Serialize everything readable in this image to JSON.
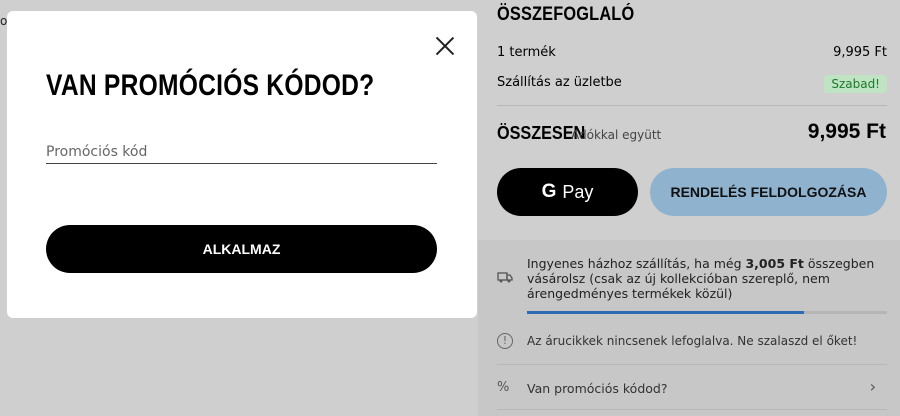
{
  "background_hint": {
    "left_edge_text": "o"
  },
  "summary": {
    "title": "ÖSSZEFOGLALÓ",
    "items_label": "1 termék",
    "items_value": "9,995 Ft",
    "shipping_label": "Szállítás az üzletbe",
    "shipping_badge": "Szabad!",
    "total_label": "ÖSSZESEN",
    "total_sub": "Adókkal együtt",
    "total_value": "9,995 Ft",
    "gpay_label": "Pay",
    "gpay_g": "G",
    "order_button": "RENDELÉS FELDOLGOZÁSA"
  },
  "shipping_info": {
    "text_before": "Ingyenes házhoz szállítás, ha még ",
    "amount": "3,005 Ft",
    "text_after": " összegben vásárolsz (csak az új kollekcióban szereplő, nem árengedményes termékek közül)",
    "progress_fraction": 0.77
  },
  "notice": {
    "text": "Az árucikkek nincsenek lefoglalva. Ne szalaszd el őket!"
  },
  "promo_row": {
    "label": "Van promóciós kódod?"
  },
  "modal": {
    "title": "VAN PROMÓCIÓS KÓDOD?",
    "input_placeholder": "Promóciós kód",
    "input_value": "",
    "apply_button": "ALKALMAZ"
  },
  "colors": {
    "accent_blue": "#8fb2cf",
    "progress_blue": "#2d6bb5",
    "free_badge_bg": "#bfe3c3",
    "free_badge_text": "#1d7a2c"
  }
}
